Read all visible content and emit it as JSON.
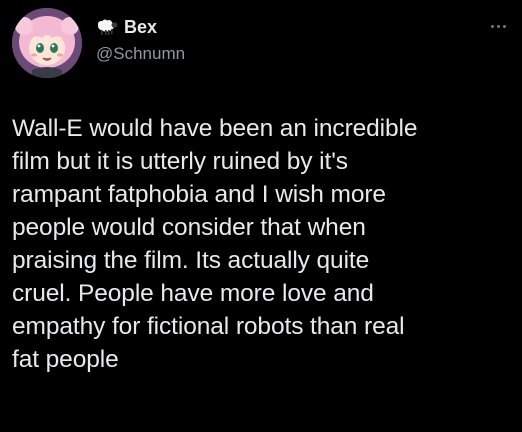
{
  "author": {
    "display_name": "Bex",
    "handle": "@Schnumn",
    "name_badge_icon": "sheep-icon",
    "avatar_colors": {
      "hair": "#f3b9d2",
      "background": "#6b4a77"
    }
  },
  "tweet": {
    "text": "Wall-E would have been an incredible\nfilm but it is utterly ruined by it's\nrampant fatphobia and I wish more\npeople would consider that when\npraising the film. Its actually quite\ncruel. People have more love and\nempathy for fictional robots than real\nfat people"
  },
  "actions": {
    "more_icon": "more-horizontal-icon"
  },
  "colors": {
    "background": "#000000",
    "text_primary": "#e7e9ea",
    "text_secondary": "#8b98a5"
  }
}
